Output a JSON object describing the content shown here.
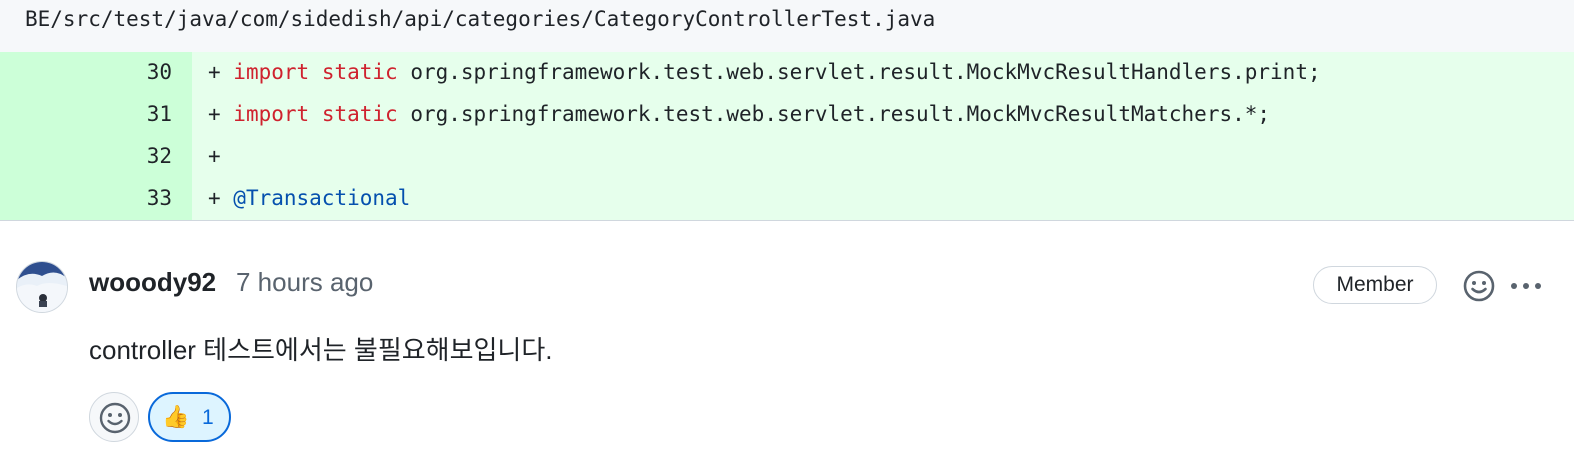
{
  "file": {
    "path": "BE/src/test/java/com/sidedish/api/categories/CategoryControllerTest.java"
  },
  "diff_lines": [
    {
      "number": "30",
      "prefix": "+ ",
      "keyword1": "import",
      "keyword2": "static",
      "rest": " org.springframework.test.web.servlet.result.MockMvcResultHandlers.print;"
    },
    {
      "number": "31",
      "prefix": "+ ",
      "keyword1": "import",
      "keyword2": "static",
      "rest": " org.springframework.test.web.servlet.result.MockMvcResultMatchers.*;"
    },
    {
      "number": "32",
      "prefix": "+",
      "keyword1": "",
      "keyword2": "",
      "rest": ""
    },
    {
      "number": "33",
      "prefix": "+ ",
      "annotation": "@Transactional"
    }
  ],
  "comment": {
    "author": "wooody92",
    "time": "7 hours ago",
    "badge": "Member",
    "body": "controller 테스트에서는 불필요해보입니다.",
    "reactions": [
      {
        "emoji": "👍",
        "count": "1"
      }
    ]
  },
  "icons": {
    "header_emoji": "smiley-icon",
    "more": "kebab-horizontal-icon",
    "add_reaction": "smiley-icon"
  },
  "colors": {
    "addition_bg": "#e6ffec",
    "addition_gutter": "#ccffd8",
    "keyword": "#cf222e",
    "annotation": "#0550ae",
    "reaction_border": "#0969da"
  }
}
